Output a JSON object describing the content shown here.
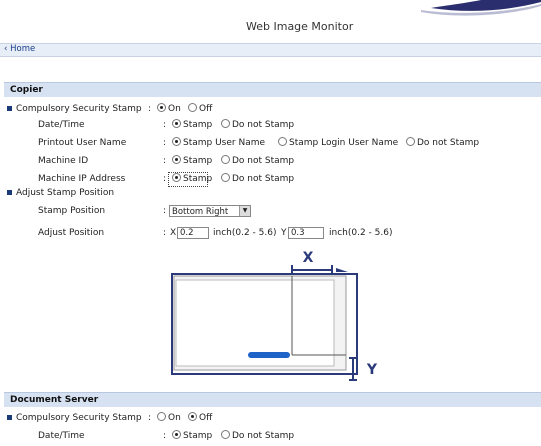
{
  "header": {
    "title": "Web Image Monitor"
  },
  "nav": {
    "home_label": "Home"
  },
  "copier": {
    "title": "Copier",
    "compulsory_label": "Compulsory Security Stamp",
    "compulsory_on": "On",
    "compulsory_off": "Off",
    "datetime_label": "Date/Time",
    "datetime_stamp": "Stamp",
    "datetime_nostamp": "Do not Stamp",
    "printout_label": "Printout User Name",
    "printout_opt1": "Stamp User Name",
    "printout_opt2": "Stamp Login User Name",
    "printout_opt3": "Do not Stamp",
    "machineid_label": "Machine ID",
    "machineid_stamp": "Stamp",
    "machineid_nostamp": "Do not Stamp",
    "machineip_label": "Machine IP Address",
    "machineip_stamp": "Stamp",
    "machineip_nostamp": "Do not Stamp",
    "adjust_label": "Adjust Stamp Position",
    "stamppos_label": "Stamp Position",
    "stamppos_value": "Bottom Right",
    "adjustpos_label": "Adjust Position",
    "x_prefix": "X",
    "x_value": "0.2",
    "x_unit": "inch(0.2 - 5.6)",
    "y_prefix": "Y",
    "y_value": "0.3",
    "y_unit": "inch(0.2 - 5.6)",
    "diagram_x": "X",
    "diagram_y": "Y"
  },
  "docserver": {
    "title": "Document Server",
    "compulsory_label": "Compulsory Security Stamp",
    "compulsory_on": "On",
    "compulsory_off": "Off",
    "datetime_label": "Date/Time",
    "datetime_stamp": "Stamp",
    "datetime_nostamp": "Do not Stamp"
  },
  "colors": {
    "accent": "#1b3a7a",
    "section_bg": "#d6e1f1",
    "stamp_blue": "#1d63c8"
  }
}
